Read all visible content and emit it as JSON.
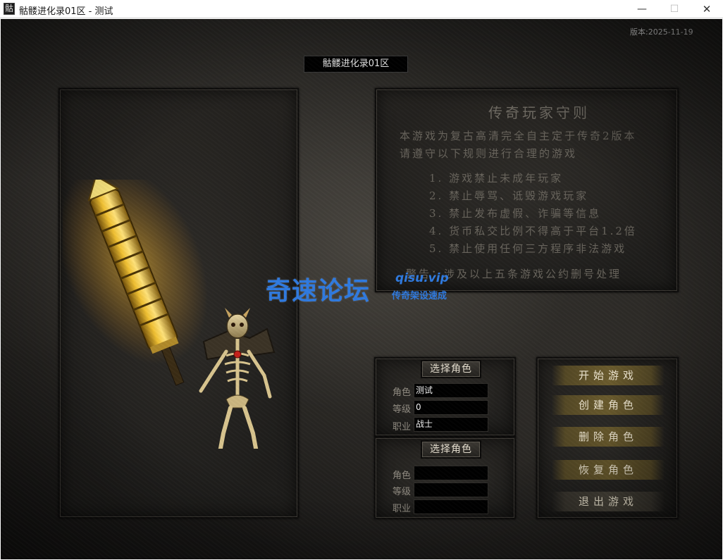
{
  "window": {
    "title": "骷髅进化录01区 - 测试",
    "icon_glyph": "骷",
    "minimize_glyph": "—",
    "maximize_glyph": "☐",
    "close_glyph": "✕"
  },
  "version": "版本:2025-11-19",
  "server_name": "骷髅进化录01区",
  "rules": {
    "title": "传奇玩家守则",
    "intro": [
      "本游戏为复古高清完全自主定于传奇2版本",
      "请遵守以下规则进行合理的游戏"
    ],
    "items": [
      "1. 游戏禁止未成年玩家",
      "2. 禁止辱骂、诋毁游戏玩家",
      "3. 禁止发布虚假、诈骗等信息",
      "4. 货币私交比例不得高于平台1.2倍",
      "5. 禁止使用任何三方程序非法游戏"
    ],
    "warning": "警告：涉及以上五条游戏公约删号处理"
  },
  "slots": [
    {
      "button_label": "选择角色",
      "labels": {
        "name": "角色",
        "level": "等级",
        "class": "职业"
      },
      "values": {
        "name": "测试",
        "level": "0",
        "class": "战士"
      }
    },
    {
      "button_label": "选择角色",
      "labels": {
        "name": "角色",
        "level": "等级",
        "class": "职业"
      },
      "values": {
        "name": "",
        "level": "",
        "class": ""
      }
    }
  ],
  "menu": {
    "start": "开始游戏",
    "create": "创建角色",
    "delete": "删除角色",
    "restore": "恢复角色",
    "exit": "退出游戏"
  },
  "watermark": {
    "main": "奇速论坛",
    "url": "qisu.vip",
    "sub": "传奇架设速成"
  },
  "colors": {
    "menu_gold": "#6e5e2e",
    "watermark_blue": "#2f7ae0",
    "field_bg": "#000000"
  }
}
